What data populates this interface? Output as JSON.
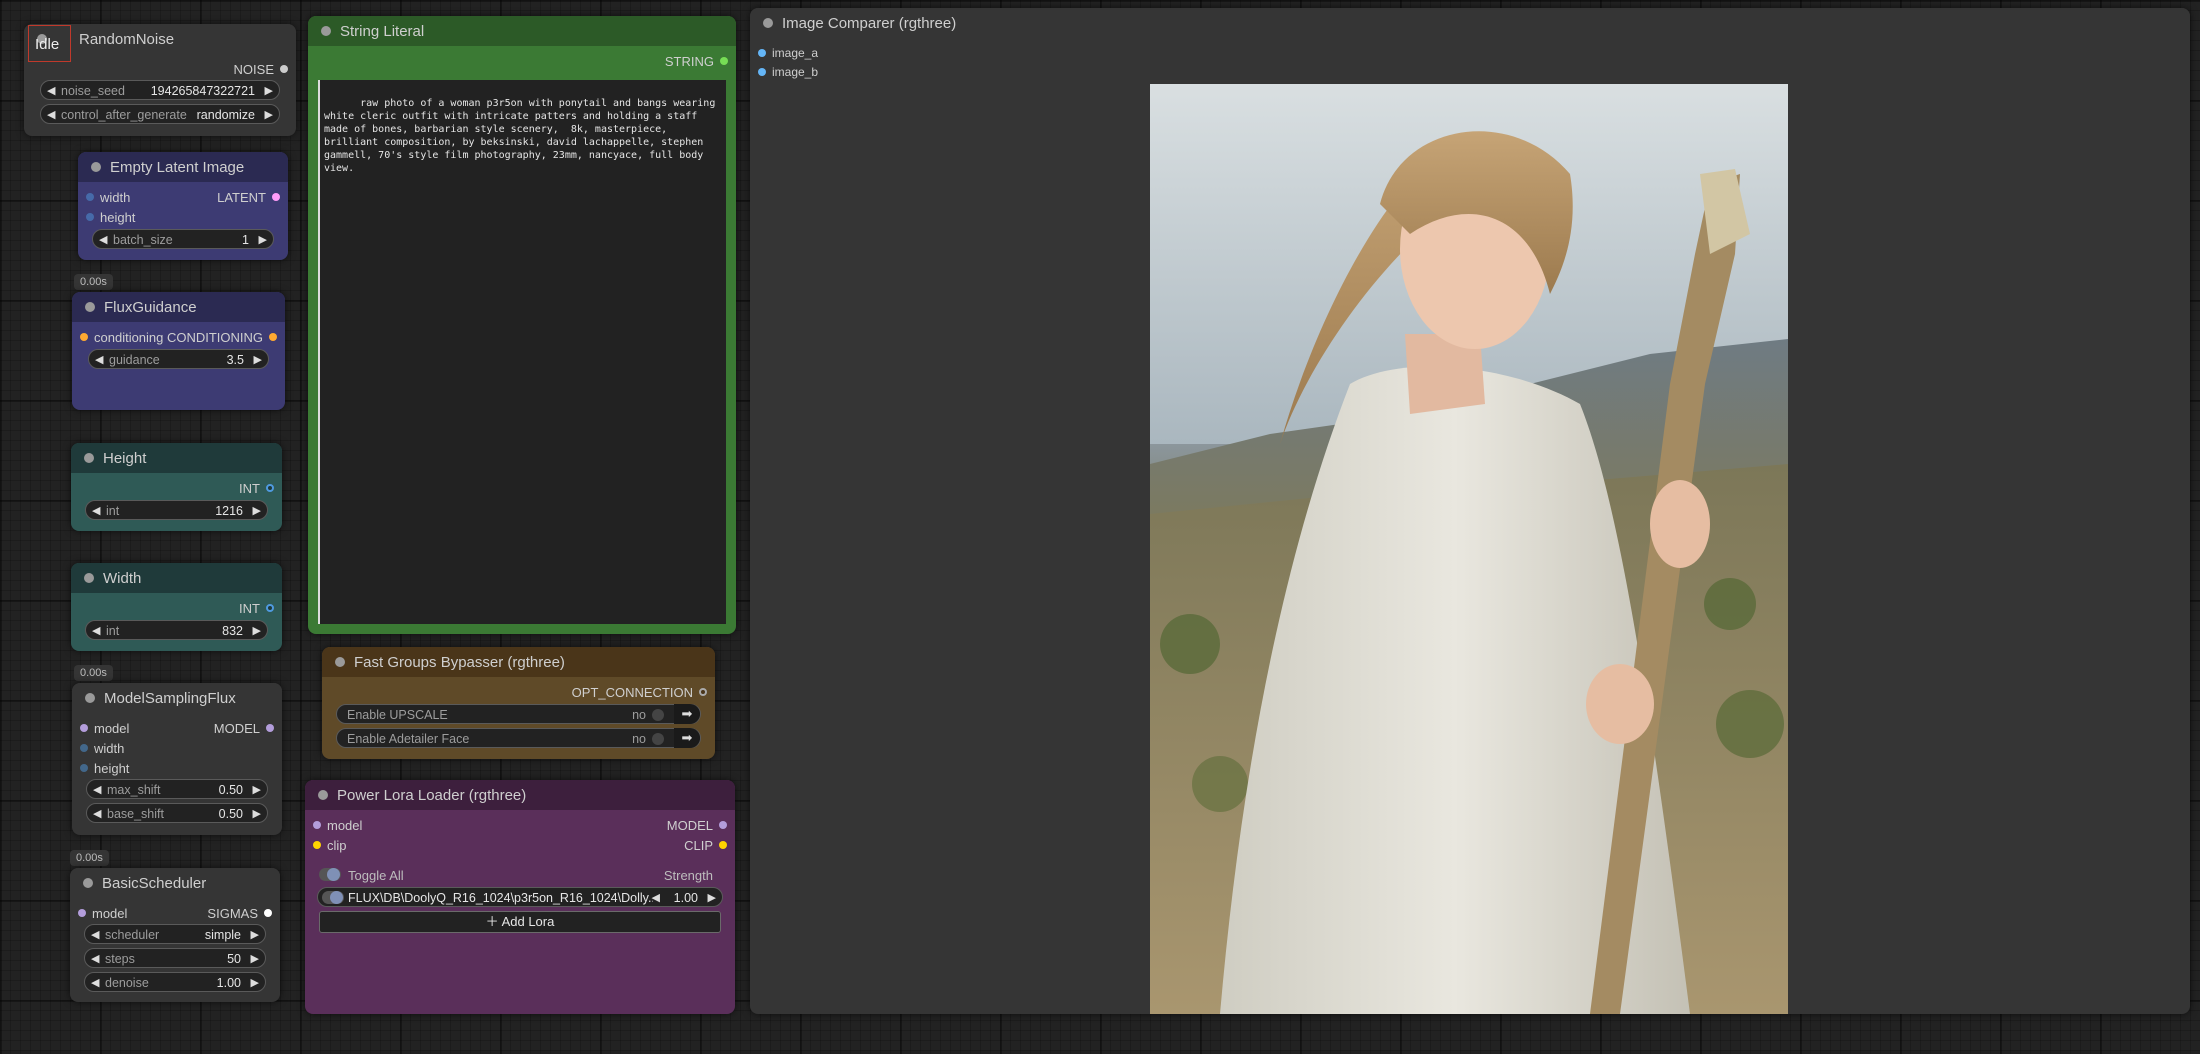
{
  "status": {
    "label": "Idle"
  },
  "colors": {
    "node_grey": "#353535",
    "node_purple_title": "#2b2a52",
    "node_purple_body": "#3d3b73",
    "node_teal_title": "#1f3a3a",
    "node_teal_body": "#2f5a56",
    "node_green": "#3b7a34",
    "node_brown_title": "#4a3519",
    "node_brown_body": "#5f4a28",
    "node_magenta_title": "#3d1f3d",
    "node_magenta_body": "#5a2f5a",
    "slot_model": "#b39ddb",
    "slot_clip": "#ffd500",
    "slot_string": "#77dd55",
    "slot_conditioning": "#ffa931",
    "slot_latent": "#ff9cf9",
    "slot_int": "#4f9ae0",
    "slot_image": "#64b5f6"
  },
  "nodes": {
    "random_noise": {
      "title": "RandomNoise",
      "output": "NOISE",
      "widgets": [
        {
          "label": "noise_seed",
          "value": "194265847322721"
        },
        {
          "label": "control_after_generate",
          "value": "randomize"
        }
      ]
    },
    "empty_latent": {
      "title": "Empty Latent Image",
      "inputs": [
        "width",
        "height"
      ],
      "output": "LATENT",
      "widgets": [
        {
          "label": "batch_size",
          "value": "1"
        }
      ]
    },
    "flux_guidance": {
      "timing": "0.00s",
      "title": "FluxGuidance",
      "input": "conditioning",
      "output": "CONDITIONING",
      "widgets": [
        {
          "label": "guidance",
          "value": "3.5"
        }
      ]
    },
    "height": {
      "title": "Height",
      "output": "INT",
      "widgets": [
        {
          "label": "int",
          "value": "1216"
        }
      ]
    },
    "width": {
      "title": "Width",
      "output": "INT",
      "widgets": [
        {
          "label": "int",
          "value": "832"
        }
      ]
    },
    "model_sampling_flux": {
      "timing": "0.00s",
      "title": "ModelSamplingFlux",
      "inputs": [
        "model",
        "width",
        "height"
      ],
      "output": "MODEL",
      "widgets": [
        {
          "label": "max_shift",
          "value": "0.50"
        },
        {
          "label": "base_shift",
          "value": "0.50"
        }
      ]
    },
    "basic_scheduler": {
      "timing": "0.00s",
      "title": "BasicScheduler",
      "input": "model",
      "output": "SIGMAS",
      "widgets": [
        {
          "label": "scheduler",
          "value": "simple"
        },
        {
          "label": "steps",
          "value": "50"
        },
        {
          "label": "denoise",
          "value": "1.00"
        }
      ]
    },
    "string_literal": {
      "title": "String Literal",
      "output": "STRING",
      "text": "raw photo of a woman p3r5on with ponytail and bangs wearing white cleric outfit with intricate patters and holding a staff made of bones, barbarian style scenery,  8k, masterpiece, brilliant composition, by beksinski, david lachappelle, stephen gammell, 70's style film photography, 23mm, nancyace, full body view."
    },
    "fast_groups_bypasser": {
      "title": "Fast Groups Bypasser (rgthree)",
      "output": "OPT_CONNECTION",
      "rows": [
        {
          "label": "Enable UPSCALE",
          "value": "no"
        },
        {
          "label": "Enable Adetailer Face",
          "value": "no"
        }
      ]
    },
    "power_lora_loader": {
      "title": "Power Lora Loader (rgthree)",
      "inputs": [
        "model",
        "clip"
      ],
      "outputs": [
        "MODEL",
        "CLIP"
      ],
      "toggle_all": "Toggle All",
      "strength_header": "Strength",
      "lora": {
        "name": "FLUX\\DB\\DoolyQ_R16_1024\\p3r5on_R16_1024\\Dolly...",
        "strength": "1.00"
      },
      "add_lora": "Add Lora"
    },
    "image_comparer": {
      "title": "Image Comparer (rgthree)",
      "inputs": [
        "image_a",
        "image_b"
      ]
    }
  }
}
